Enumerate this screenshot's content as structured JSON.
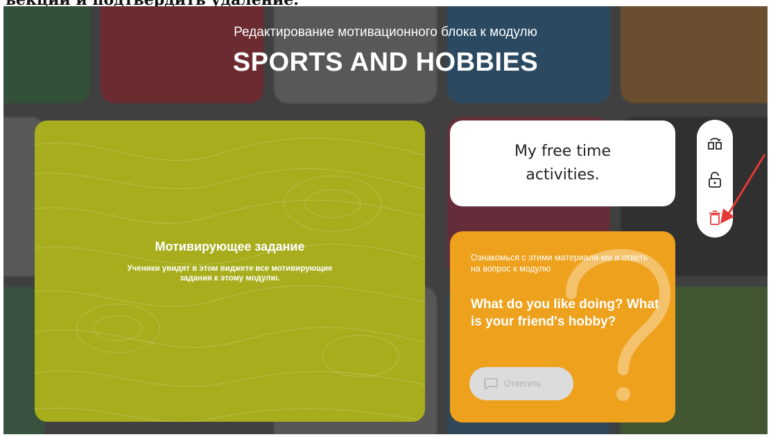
{
  "top_cut_text": "ьекции и подтвердить удаление.",
  "header": {
    "subtitle": "Редактирование мотивационного блока к модулю",
    "title": "SPORTS AND HOBBIES"
  },
  "motivation_card": {
    "title": "Мотивирующее задание",
    "description": "Ученики увидят в этом виджете все мотивирующие задания к этому модулю.",
    "color": "#a7ad1c"
  },
  "topic_card": {
    "text": "My free time activities."
  },
  "toolbar": {
    "items": [
      {
        "icon": "swap-icon"
      },
      {
        "icon": "lock-open-icon"
      },
      {
        "icon": "trash-icon",
        "color": "#e53935"
      }
    ]
  },
  "question_card": {
    "intro": "Ознакомься с этими материала-ми и ответь на вопрос к модулю",
    "question": "What do you like doing? What is your friend's hobby?",
    "reply_label": "Ответить",
    "color": "#eea11c"
  },
  "annotation": {
    "arrow_color": "#e53935"
  }
}
